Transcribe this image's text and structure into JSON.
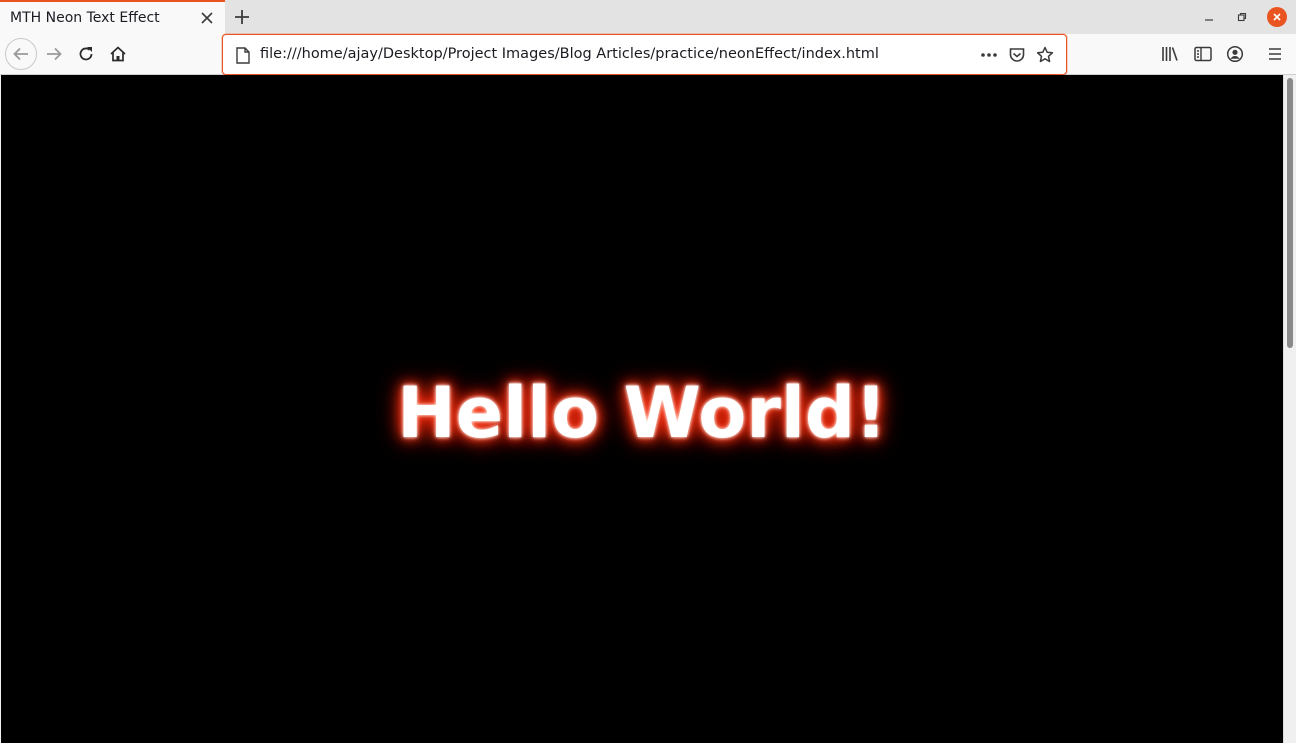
{
  "tab": {
    "title": "MTH Neon Text Effect"
  },
  "urlbar": {
    "url": "file:///home/ajay/Desktop/Project Images/Blog Articles/practice/neonEffect/index.html"
  },
  "page": {
    "heading": "Hello World!",
    "glow_color": "#ff2a00",
    "background": "#000000"
  },
  "icons": {
    "tab_close": "close-icon",
    "new_tab": "plus-icon",
    "back": "arrow-left-icon",
    "forward": "arrow-right-icon",
    "reload": "reload-icon",
    "home": "home-icon",
    "page": "page-icon",
    "more": "ellipsis-icon",
    "pocket": "pocket-icon",
    "bookmark": "star-icon",
    "library": "library-icon",
    "sidebar": "sidebar-icon",
    "account": "account-icon",
    "menu": "hamburger-menu-icon"
  },
  "colors": {
    "accent": "#e95420"
  }
}
